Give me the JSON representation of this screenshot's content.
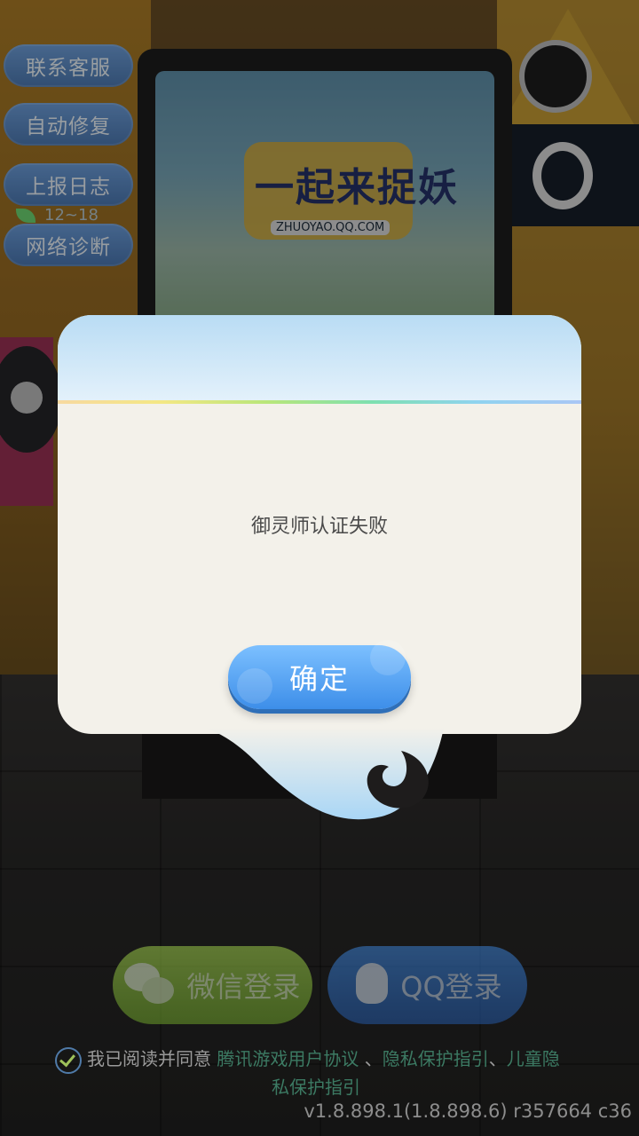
{
  "side_menu": {
    "customer_service": "联系客服",
    "auto_repair": "自动修复",
    "report_log": "上报日志",
    "network_diag": "网络诊断"
  },
  "weather": {
    "temp": "12~18"
  },
  "billboard": {
    "logo_text": "一起来捉妖",
    "logo_url": "ZHUOYAO.QQ.COM"
  },
  "dialog": {
    "message": "御灵师认证失败",
    "confirm": "确定"
  },
  "login": {
    "wechat": "微信登录",
    "qq": "QQ登录"
  },
  "agreement": {
    "prefix": "我已阅读并同意",
    "user_agreement": "腾讯游戏用户协议",
    "sep": "、",
    "privacy": "隐私保护指引",
    "children_part1": "儿童隐",
    "children_part2": "私保护指引"
  },
  "version": "v1.8.898.1(1.8.898.6) r357664 c36",
  "colors": {
    "accent_blue": "#3d8ee9",
    "wechat_green": "#6b9e2a",
    "link_green": "#3c7a63"
  }
}
